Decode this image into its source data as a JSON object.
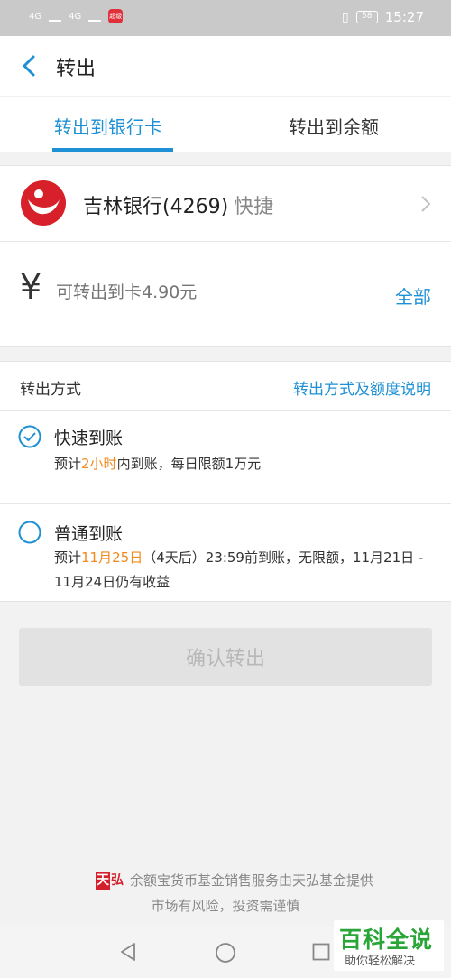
{
  "status_bar": {
    "network_1": "4G",
    "network_2": "4G",
    "app_badge": "超级",
    "battery": "58",
    "time": "15:27"
  },
  "header": {
    "title": "转出"
  },
  "tabs": [
    {
      "label": "转出到银行卡",
      "active": true
    },
    {
      "label": "转出到余额",
      "active": false
    }
  ],
  "bank": {
    "name": "吉林银行(4269)",
    "tag": "快捷"
  },
  "amount": {
    "currency_symbol": "¥",
    "placeholder": "可转出到卡4.90元",
    "all_label": "全部"
  },
  "method": {
    "title": "转出方式",
    "info_link": "转出方式及额度说明",
    "options": [
      {
        "title": "快速到账",
        "selected": true,
        "desc_pre": "预计",
        "desc_highlight": "2小时",
        "desc_post": "内到账，每日限额1万元"
      },
      {
        "title": "普通到账",
        "selected": false,
        "desc_pre": "预计",
        "desc_highlight": "11月25日",
        "desc_post": "（4天后）23:59前到账，无限额，11月21日 - 11月24日仍有收益"
      }
    ]
  },
  "confirm_label": "确认转出",
  "footer": {
    "logo_a": "天",
    "logo_b": "弘",
    "line1": "余额宝货币基金销售服务由天弘基金提供",
    "line2": "市场有风险，投资需谨慎"
  },
  "watermark": {
    "main": "百科全说",
    "sub": "助你轻松解决"
  },
  "colors": {
    "accent": "#1e90d5",
    "highlight": "#f08a1c",
    "bank_red": "#d8202a"
  }
}
